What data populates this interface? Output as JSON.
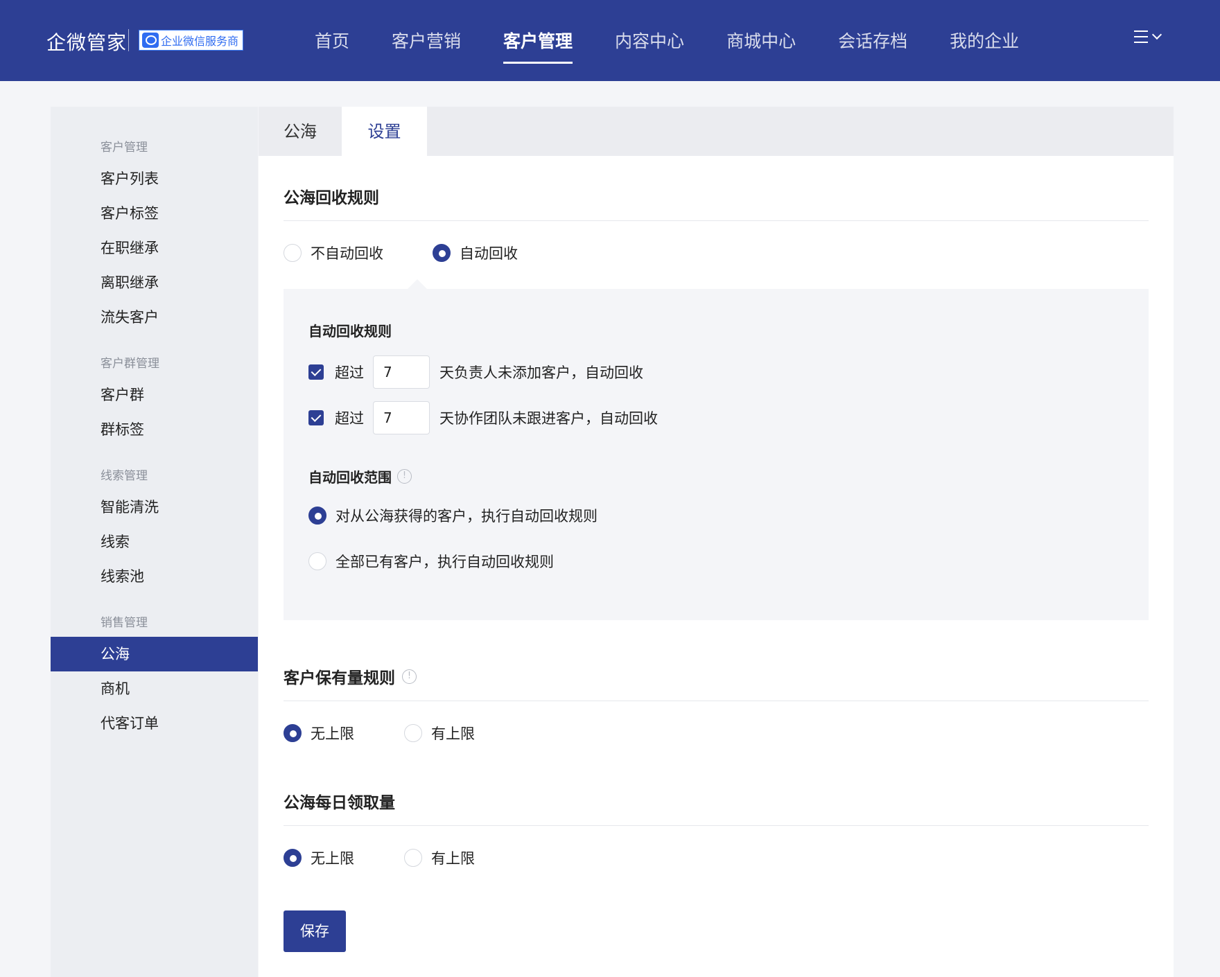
{
  "header": {
    "brand": "企微管家",
    "badge": "企业微信服务商",
    "nav": [
      "首页",
      "客户营销",
      "客户管理",
      "内容中心",
      "商城中心",
      "会话存档",
      "我的企业"
    ],
    "active_nav": "客户管理",
    "menu_toggle_label": "三"
  },
  "sidebar": {
    "groups": [
      {
        "title": "客户管理",
        "items": [
          "客户列表",
          "客户标签",
          "在职继承",
          "离职继承",
          "流失客户"
        ]
      },
      {
        "title": "客户群管理",
        "items": [
          "客户群",
          "群标签"
        ]
      },
      {
        "title": "线索管理",
        "items": [
          "智能清洗",
          "线索",
          "线索池"
        ]
      },
      {
        "title": "销售管理",
        "items": [
          "公海",
          "商机",
          "代客订单"
        ]
      }
    ],
    "active_item": "公海"
  },
  "tabs": {
    "items": [
      "公海",
      "设置"
    ],
    "active": "设置"
  },
  "recycle": {
    "title": "公海回收规则",
    "options": [
      "不自动回收",
      "自动回收"
    ],
    "selected": "自动回收",
    "rules_title": "自动回收规则",
    "rules": [
      {
        "checked": true,
        "prefix": "超过",
        "value": "7",
        "suffix": "天负责人未添加客户，自动回收"
      },
      {
        "checked": true,
        "prefix": "超过",
        "value": "7",
        "suffix": "天协作团队未跟进客户，自动回收"
      }
    ],
    "scope_title": "自动回收范围",
    "scope_options": [
      "对从公海获得的客户，执行自动回收规则",
      "全部已有客户，执行自动回收规则"
    ],
    "scope_selected": "对从公海获得的客户，执行自动回收规则"
  },
  "retention": {
    "title": "客户保有量规则",
    "options": [
      "无上限",
      "有上限"
    ],
    "selected": "无上限"
  },
  "daily_claim": {
    "title": "公海每日领取量",
    "options": [
      "无上限",
      "有上限"
    ],
    "selected": "无上限"
  },
  "save_label": "保存",
  "colors": {
    "primary": "#2d3f94",
    "page_bg": "#f4f5f8",
    "sidebar_bg": "#eceef2"
  }
}
